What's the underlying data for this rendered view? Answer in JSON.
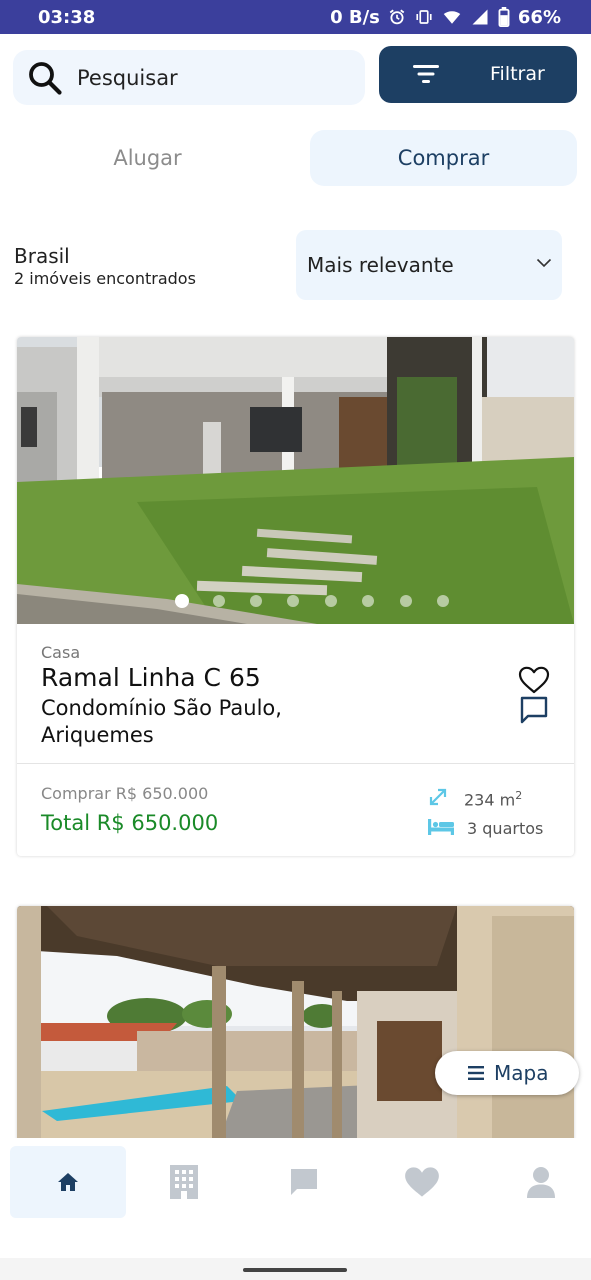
{
  "status_bar": {
    "time": "03:38",
    "net_speed": "0 B/s",
    "battery": "66%"
  },
  "search": {
    "placeholder": "Pesquisar"
  },
  "filter": {
    "label": "Filtrar"
  },
  "mode_tabs": {
    "rent": "Alugar",
    "buy": "Comprar",
    "selected": "Comprar"
  },
  "location": {
    "title": "Brasil",
    "count": "2 imóveis encontrados"
  },
  "sort": {
    "selected": "Mais relevante"
  },
  "listings": [
    {
      "type": "Casa",
      "street": "Ramal Linha C 65",
      "address": "Condomínio São Paulo, Ariquemes",
      "price_label": "Comprar R$ 650.000",
      "total": "Total R$ 650.000",
      "area": "234 m",
      "area_unit_sup": "2",
      "bedrooms": "3 quartos",
      "photo_count": 8,
      "active_photo": 1
    }
  ],
  "map_button": {
    "label": "Mapa"
  },
  "bottom_nav": {
    "items": [
      "home-icon",
      "building-icon",
      "chat-icon",
      "heart-icon",
      "profile-icon"
    ],
    "active": "home-icon"
  },
  "colors": {
    "status_bar": "#3b3f9c",
    "primary": "#1d3f63",
    "accent_light": "#edf5fd",
    "price_green": "#1a8a28",
    "icon_teal": "#5dc7e6"
  }
}
